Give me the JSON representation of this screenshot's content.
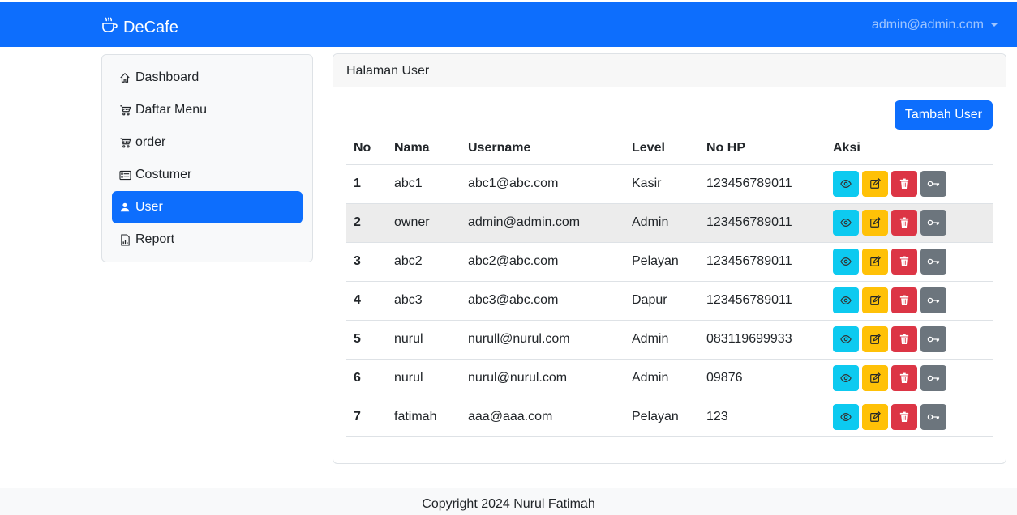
{
  "navbar": {
    "brand": "DeCafe",
    "user": "admin@admin.com",
    "brand_icon": "coffee-icon"
  },
  "sidebar": {
    "items": [
      {
        "label": "Dashboard",
        "icon": "house-icon",
        "active": false
      },
      {
        "label": "Daftar Menu",
        "icon": "cart-icon",
        "active": false
      },
      {
        "label": "order",
        "icon": "cart-icon",
        "active": false
      },
      {
        "label": "Costumer",
        "icon": "card-list-icon",
        "active": false
      },
      {
        "label": "User",
        "icon": "person-icon",
        "active": true
      },
      {
        "label": "Report",
        "icon": "report-icon",
        "active": false
      }
    ]
  },
  "card": {
    "title": "Halaman User",
    "add_button": "Tambah User"
  },
  "table": {
    "headers": [
      "No",
      "Nama",
      "Username",
      "Level",
      "No HP",
      "Aksi"
    ],
    "rows": [
      {
        "no": "1",
        "nama": "abc1",
        "username": "abc1@abc.com",
        "level": "Kasir",
        "hp": "123456789011"
      },
      {
        "no": "2",
        "nama": "owner",
        "username": "admin@admin.com",
        "level": "Admin",
        "hp": "123456789011"
      },
      {
        "no": "3",
        "nama": "abc2",
        "username": "abc2@abc.com",
        "level": "Pelayan",
        "hp": "123456789011"
      },
      {
        "no": "4",
        "nama": "abc3",
        "username": "abc3@abc.com",
        "level": "Dapur",
        "hp": "123456789011"
      },
      {
        "no": "5",
        "nama": "nurul",
        "username": "nurull@nurul.com",
        "level": "Admin",
        "hp": "083119699933"
      },
      {
        "no": "6",
        "nama": "nurul",
        "username": "nurul@nurul.com",
        "level": "Admin",
        "hp": "09876"
      },
      {
        "no": "7",
        "nama": "fatimah",
        "username": "aaa@aaa.com",
        "level": "Pelayan",
        "hp": "123"
      }
    ]
  },
  "footer": {
    "text": "Copyright 2024 Nurul Fatimah"
  },
  "colors": {
    "primary": "#0d6efd",
    "info": "#0dcaf0",
    "warning": "#ffc107",
    "danger": "#dc3545",
    "secondary": "#6c757d"
  }
}
